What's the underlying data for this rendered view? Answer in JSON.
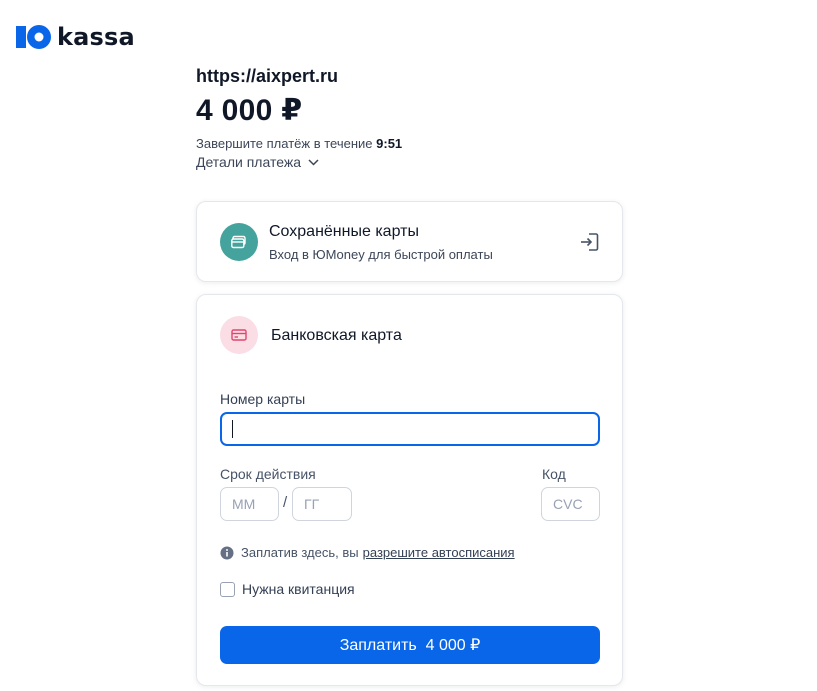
{
  "brand": {
    "name": "kassa",
    "logo_icon": "yumoney-logo-icon",
    "color": "#0a66e8"
  },
  "merchant": "https://aixpert.ru",
  "amount": "4 000 ₽",
  "timer": {
    "prefix": "Завершите платёж в течение",
    "value": "9:51"
  },
  "details_label": "Детали платежа",
  "saved_cards": {
    "title": "Сохранённые карты",
    "subtitle": "Вход в ЮMoney для быстрой оплаты",
    "icon": "wallet-icon",
    "action_icon": "login-arrow-icon"
  },
  "bank_card": {
    "title": "Банковская карта",
    "icon": "credit-card-icon",
    "card_number_label": "Номер карты",
    "card_number_value": "",
    "expiry_label": "Срок действия",
    "month_placeholder": "ММ",
    "year_placeholder": "ГГ",
    "separator": "/",
    "cvc_label": "Код",
    "cvc_placeholder": "CVC",
    "info_text": "Заплатив здесь, вы",
    "info_link": "разрешите автосписания",
    "receipt_label": "Нужна квитанция",
    "pay_button": "Заплатить  4 000 ₽"
  },
  "colors": {
    "accent": "#0a66e8",
    "teal": "#44a39c",
    "pink": "#fbdde5",
    "text": "#101828"
  }
}
